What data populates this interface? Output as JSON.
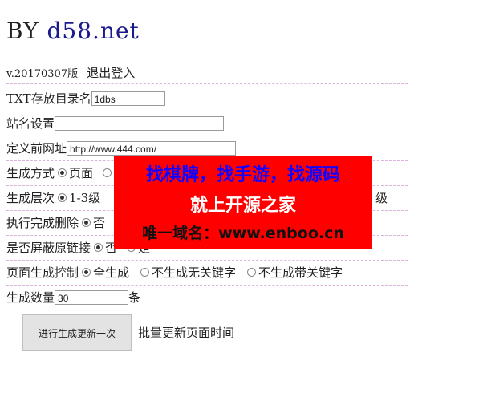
{
  "header": {
    "by": "BY",
    "site_link": "d58.net"
  },
  "version": {
    "label": "v.20170307版",
    "logout": "退出登入"
  },
  "form": {
    "dir": {
      "label": "TXT存放目录名",
      "value": "1dbs"
    },
    "site_name": {
      "label": "站名设置",
      "value": ""
    },
    "prefix_url": {
      "label": "定义前网址",
      "value": "http://www.444.com/"
    },
    "gen_mode": {
      "label": "生成方式",
      "option1": "页面"
    },
    "gen_level": {
      "label": "生成层次",
      "option1": "1-3级",
      "option_right": "级"
    },
    "delete_after": {
      "label": "执行完成删除",
      "option1": "否"
    },
    "block_links": {
      "label": "是否屏蔽原链接",
      "option1": "否",
      "option2": "是"
    },
    "page_control": {
      "label": "页面生成控制",
      "options": [
        "全生成",
        "不生成无关键字",
        "不生成带关键字"
      ]
    },
    "quantity": {
      "label": "生成数量",
      "value": "30",
      "unit": "条"
    }
  },
  "actions": {
    "run_button": "进行生成更新一次",
    "batch_note": "批量更新页面时间"
  },
  "ad": {
    "line1": "找棋牌，找手游，找源码",
    "line2": "就上开源之家",
    "line3": "唯一域名：www.enboo.cn"
  }
}
